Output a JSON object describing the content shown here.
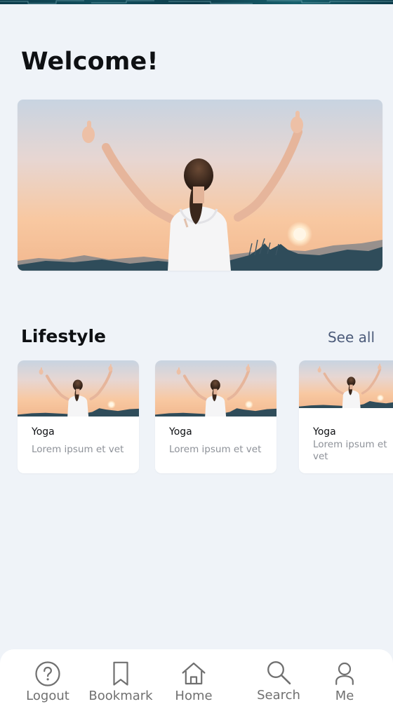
{
  "header": {
    "title": "Welcome!"
  },
  "hero": {
    "image_icon": "woman-thumbs-up-sunset-photo"
  },
  "lifestyle": {
    "section_title": "Lifestyle",
    "see_all_label": "See all",
    "cards": [
      {
        "title": "Yoga",
        "description": "Lorem ipsum et vet",
        "image_icon": "woman-thumbs-up-sunset-photo"
      },
      {
        "title": "Yoga",
        "description": "Lorem ipsum et vet",
        "image_icon": "woman-thumbs-up-sunset-photo"
      },
      {
        "title": "Yoga",
        "description": "Lorem ipsum et vet",
        "image_icon": "woman-thumbs-up-sunset-photo"
      }
    ]
  },
  "bottom_nav": {
    "items": [
      {
        "label": "Logout",
        "icon": "question-circle-icon"
      },
      {
        "label": "Bookmark",
        "icon": "bookmark-icon"
      },
      {
        "label": "Home",
        "icon": "home-icon"
      },
      {
        "label": "Search",
        "icon": "search-icon"
      },
      {
        "label": "Me",
        "icon": "user-icon"
      }
    ]
  },
  "colors": {
    "background": "#eff3f8",
    "card": "#ffffff",
    "text": "#0e1013",
    "link": "#4c5b7a",
    "muted_text": "#8d9198",
    "nav_icon": "#707070"
  }
}
